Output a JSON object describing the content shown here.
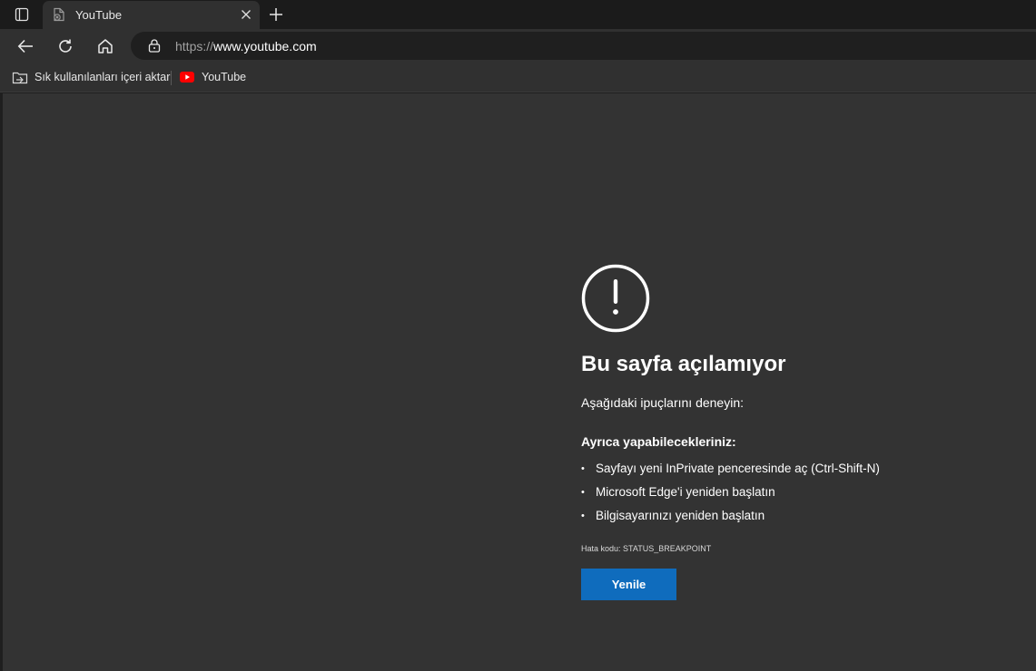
{
  "tabs": [
    {
      "title": "YouTube"
    }
  ],
  "address_bar": {
    "url_scheme": "https://",
    "url_host": "www.youtube.com"
  },
  "favorites": {
    "items": [
      {
        "label": "Sık kullanılanları içeri aktar",
        "icon": "import-favorites-icon"
      },
      {
        "label": "YouTube",
        "icon": "youtube-icon"
      }
    ]
  },
  "error_page": {
    "title": "Bu sayfa açılamıyor",
    "hint": "Aşağıdaki ipuçlarını deneyin:",
    "subheading": "Ayrıca yapabilecekleriniz:",
    "suggestions": [
      "Sayfayı yeni InPrivate penceresinde aç (Ctrl-Shift-N)",
      "Microsoft Edge'i yeniden başlatın",
      "Bilgisayarınızı yeniden başlatın"
    ],
    "error_code": "Hata kodu: STATUS_BREAKPOINT",
    "reload_label": "Yenile"
  },
  "colors": {
    "accent": "#0f6cbd",
    "content_bg": "#333333",
    "youtube_red": "#ff0000"
  }
}
